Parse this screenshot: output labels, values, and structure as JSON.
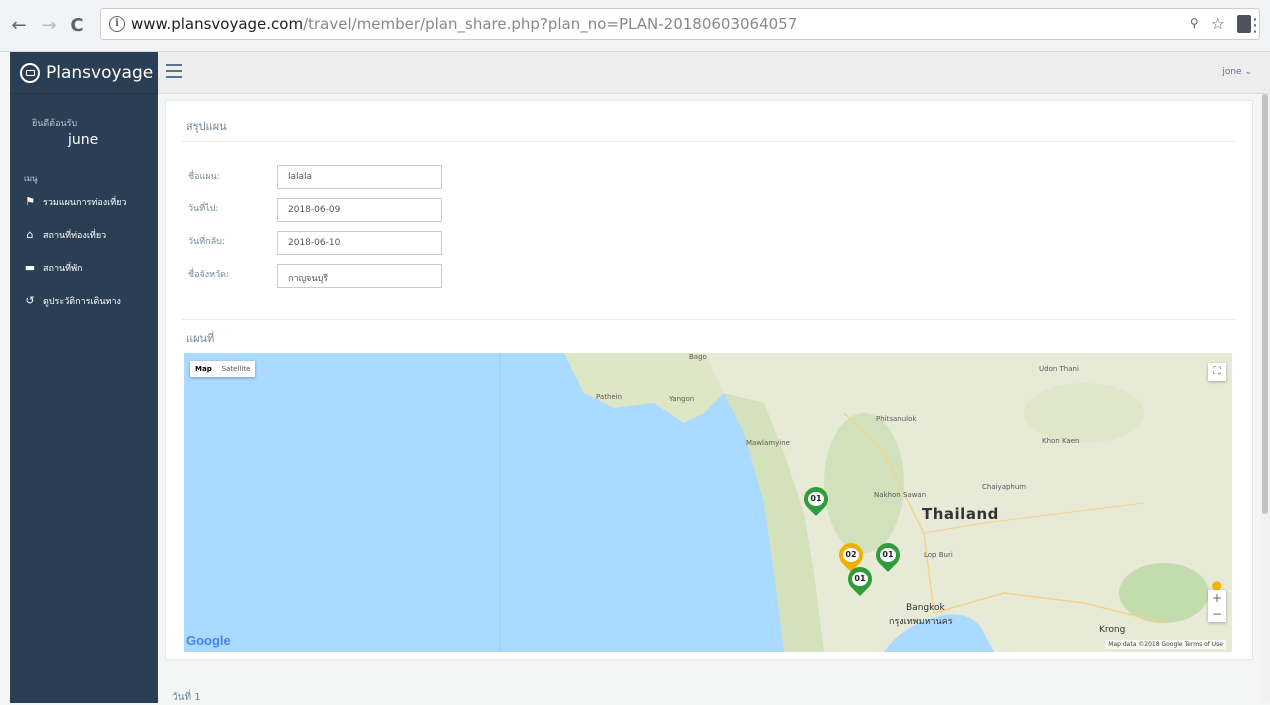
{
  "browser": {
    "url_host": "www.plansvoyage.com",
    "url_path": "/travel/member/plan_share.php?plan_no=PLAN-20180603064057",
    "back_icon": "←",
    "forward_icon": "→",
    "reload_icon": "C",
    "zoom_icon": "🔍",
    "star_icon": "☆",
    "menu_icon": "⋮"
  },
  "sidebar": {
    "brand": "Plansvoyage",
    "welcome_label": "ยินดีต้อนรับ",
    "user_name": "june",
    "menu_heading": "เมนู",
    "items": [
      {
        "label": "รวมแผนการท่องเที่ยว",
        "icon": "suitcase-icon"
      },
      {
        "label": "สถานที่ท่องเที่ยว",
        "icon": "home-icon"
      },
      {
        "label": "สถานที่พัก",
        "icon": "bed-icon"
      },
      {
        "label": "ดูประวัติการเดินทาง",
        "icon": "history-icon"
      }
    ]
  },
  "topbar": {
    "user_menu": "jone ⌄"
  },
  "panel": {
    "title": "สรุปแผน",
    "fields": [
      {
        "label": "ชื่อแผน:",
        "value": "lalala"
      },
      {
        "label": "วันที่ไป:",
        "value": "2018-06-09"
      },
      {
        "label": "วันที่กลับ:",
        "value": "2018-06-10"
      },
      {
        "label": "ชื่อจังหวัด:",
        "value": "กาญจนบุรี"
      }
    ],
    "map_title": "แผนที่",
    "day_label": "วันที่ 1"
  },
  "map": {
    "type_map": "Map",
    "type_satellite": "Satellite",
    "country": "Thailand",
    "labels": [
      "Yangon",
      "Pathein",
      "Mawlamyine",
      "Phitsanulok",
      "Nakhon Sawan",
      "Lop Buri",
      "Chaiyaphum",
      "Khon Kaen",
      "Udon Thani",
      "Bago"
    ],
    "city": "Bangkok",
    "city_thai": "กรุงเทพมหานคร",
    "krong": "Krong",
    "google": "Google",
    "footer": "Map data ©2018 Google   Terms of Use",
    "markers": [
      {
        "text": "01",
        "color": "#2e9c3a"
      },
      {
        "text": "02",
        "color": "#f0b000"
      },
      {
        "text": "01",
        "color": "#2e9c3a"
      },
      {
        "text": "01",
        "color": "#2e9c3a"
      }
    ]
  },
  "colors": {
    "sidebar": "#2a3f54",
    "water": "#aadaff",
    "land": "#e8ead8"
  }
}
